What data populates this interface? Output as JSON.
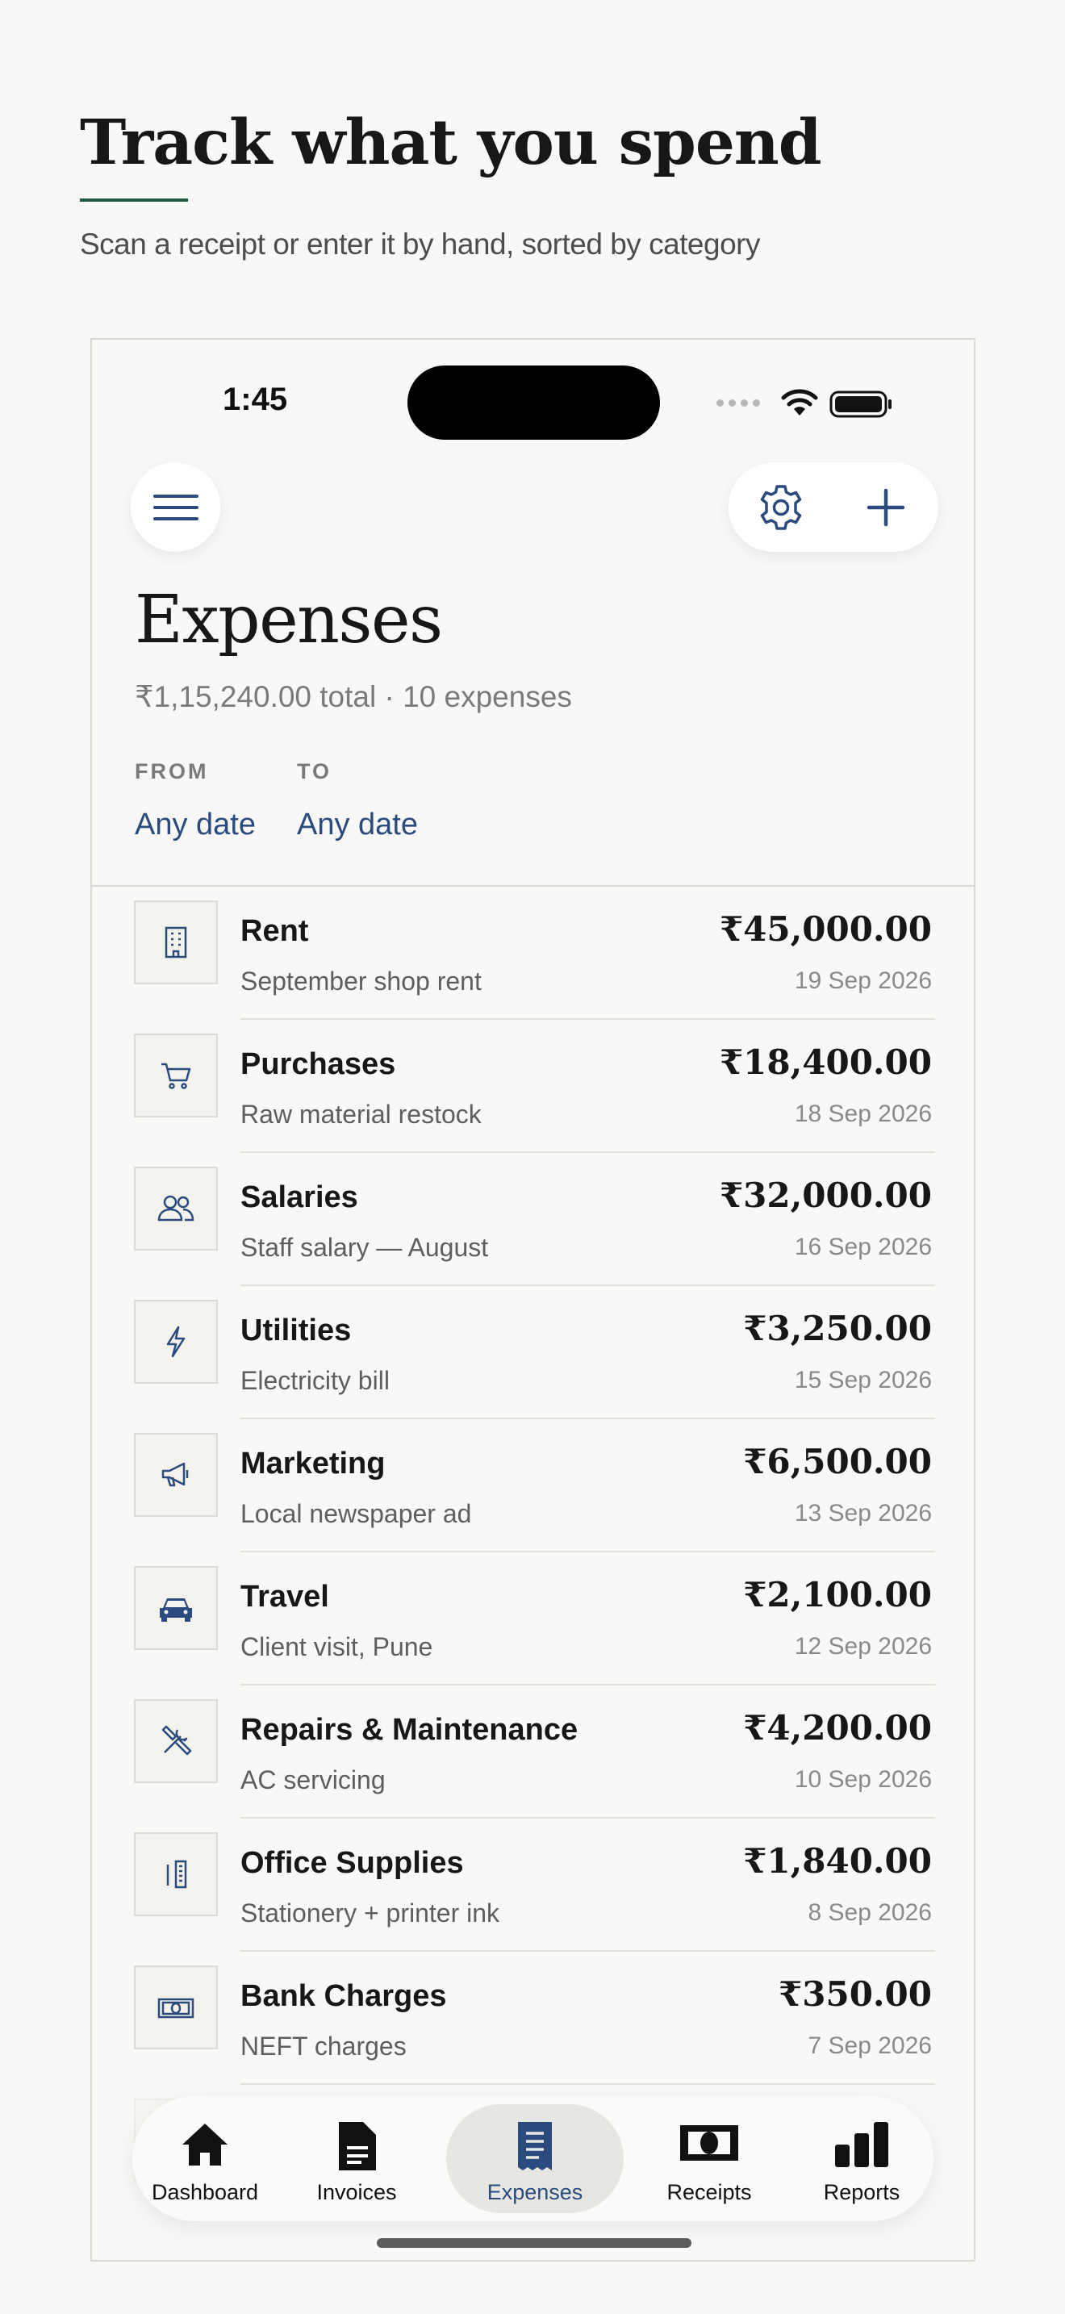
{
  "hero": {
    "title": "Track what you spend",
    "subtitle": "Scan a receipt or enter it by hand, sorted by category"
  },
  "status_bar": {
    "time": "1:45"
  },
  "header": {
    "title": "Expenses",
    "summary": "₹1,15,240.00 total · 10 expenses",
    "from_label": "FROM",
    "from_value": "Any date",
    "to_label": "TO",
    "to_value": "Any date"
  },
  "expenses": [
    {
      "icon": "building-icon",
      "category": "Rent",
      "description": "September shop rent",
      "amount": "₹45,000.00",
      "date": "19 Sep 2026"
    },
    {
      "icon": "cart-icon",
      "category": "Purchases",
      "description": "Raw material restock",
      "amount": "₹18,400.00",
      "date": "18 Sep 2026"
    },
    {
      "icon": "people-icon",
      "category": "Salaries",
      "description": "Staff salary — August",
      "amount": "₹32,000.00",
      "date": "16 Sep 2026"
    },
    {
      "icon": "lightning-icon",
      "category": "Utilities",
      "description": "Electricity bill",
      "amount": "₹3,250.00",
      "date": "15 Sep 2026"
    },
    {
      "icon": "megaphone-icon",
      "category": "Marketing",
      "description": "Local newspaper ad",
      "amount": "₹6,500.00",
      "date": "13 Sep 2026"
    },
    {
      "icon": "car-icon",
      "category": "Travel",
      "description": "Client visit, Pune",
      "amount": "₹2,100.00",
      "date": "12 Sep 2026"
    },
    {
      "icon": "tools-icon",
      "category": "Repairs & Maintenance",
      "description": "AC servicing",
      "amount": "₹4,200.00",
      "date": "10 Sep 2026"
    },
    {
      "icon": "pencil-ruler-icon",
      "category": "Office Supplies",
      "description": "Stationery + printer ink",
      "amount": "₹1,840.00",
      "date": "8 Sep 2026"
    },
    {
      "icon": "banknote-icon",
      "category": "Bank Charges",
      "description": "NEFT charges",
      "amount": "₹350.00",
      "date": "7 Sep 2026"
    }
  ],
  "tabs": [
    {
      "label": "Dashboard",
      "icon": "house-icon",
      "active": false
    },
    {
      "label": "Invoices",
      "icon": "document-icon",
      "active": false
    },
    {
      "label": "Expenses",
      "icon": "receipt-icon",
      "active": true
    },
    {
      "label": "Receipts",
      "icon": "banknote-icon",
      "active": false
    },
    {
      "label": "Reports",
      "icon": "bar-chart-icon",
      "active": false
    }
  ],
  "colors": {
    "accent": "#2b4a7d",
    "hero_rule": "#1f5c3f",
    "background": "#f8f8f6"
  }
}
